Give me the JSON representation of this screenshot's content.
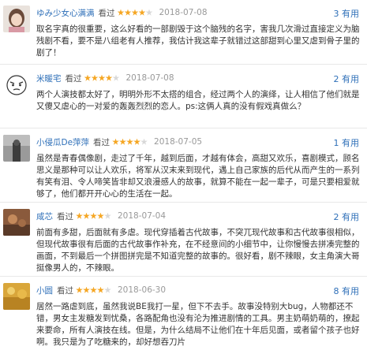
{
  "reviews": [
    {
      "user": "ゆみ少女心满满",
      "rated": "看过",
      "stars": 4,
      "date": "2018-07-08",
      "useful": "3 有用",
      "text": "取名字真的很重要，这么好看的一部剧毁于这个脑残的名字，害我几次滑过直接定义为脑残剧不看，要不是八组老有人推荐，我估计我这辈子就错过这部甜到心里又虐到骨子里的剧了！"
    },
    {
      "user": "米暖宅",
      "rated": "看过",
      "stars": 4,
      "date": "2018-07-08",
      "useful": "2 有用",
      "text": "两个人演技都太好了，明明外形不太搭的组合，经过两个人的演绎，让人相信了他们就是又傻又虐心的一对爱的轰轰烈烈的恋人。ps:这俩人真的没有假戏真做么？"
    },
    {
      "user": "小侵瓜De萍萍",
      "rated": "看过",
      "stars": 4,
      "date": "2018-07-05",
      "useful": "1 有用",
      "text": "虽然是青春偶像剧，走过了千年，越到后面，才越有体会，高甜又欢乐，喜剧模式，顾名思义是那种可以让人欢乐，将军从汉末来到现代，遇上自己家族的后代从而产生的一系列有笑有泪、令人啼笑皆非却又浪漫感人的故事，就算不能在一起一辈子，可是只要相爱就够了，他们都开开心心的生活在一起。"
    },
    {
      "user": "咸芯",
      "rated": "看过",
      "stars": 4,
      "date": "2018-07-04",
      "useful": "2 有用",
      "text": "前面有多甜，后面就有多虐。现代穿插着古代故事，不突兀现代故事和古代故事很相似，但现代故事很有后面的古代故事作补充，在不经意间的小细节中，让你慢慢去拼凑完整的画面，不到最后一个拼图拼完是不知道完整的故事的。很好看，剧不辣眼，女主角演大哥挺像男人的，不辣眼。"
    },
    {
      "user": "小圆",
      "rated": "看过",
      "stars": 4,
      "date": "2018-06-30",
      "useful": "8 有用",
      "text": "居然一路虐到底，虽然我说BE我打一星，但下不去手。故事没特别大bug，人物都还不错，男女主发糖发到忧桑，各路配角也没有沦为推进剧情的工具。男主奶萌奶萌的，撩起来要命，所有人演技在线。但是，为什么结局不让他们在十年后见面，或者留个孩子也好啊。我只是为了吃糖来的，却好想吞刀片"
    }
  ]
}
